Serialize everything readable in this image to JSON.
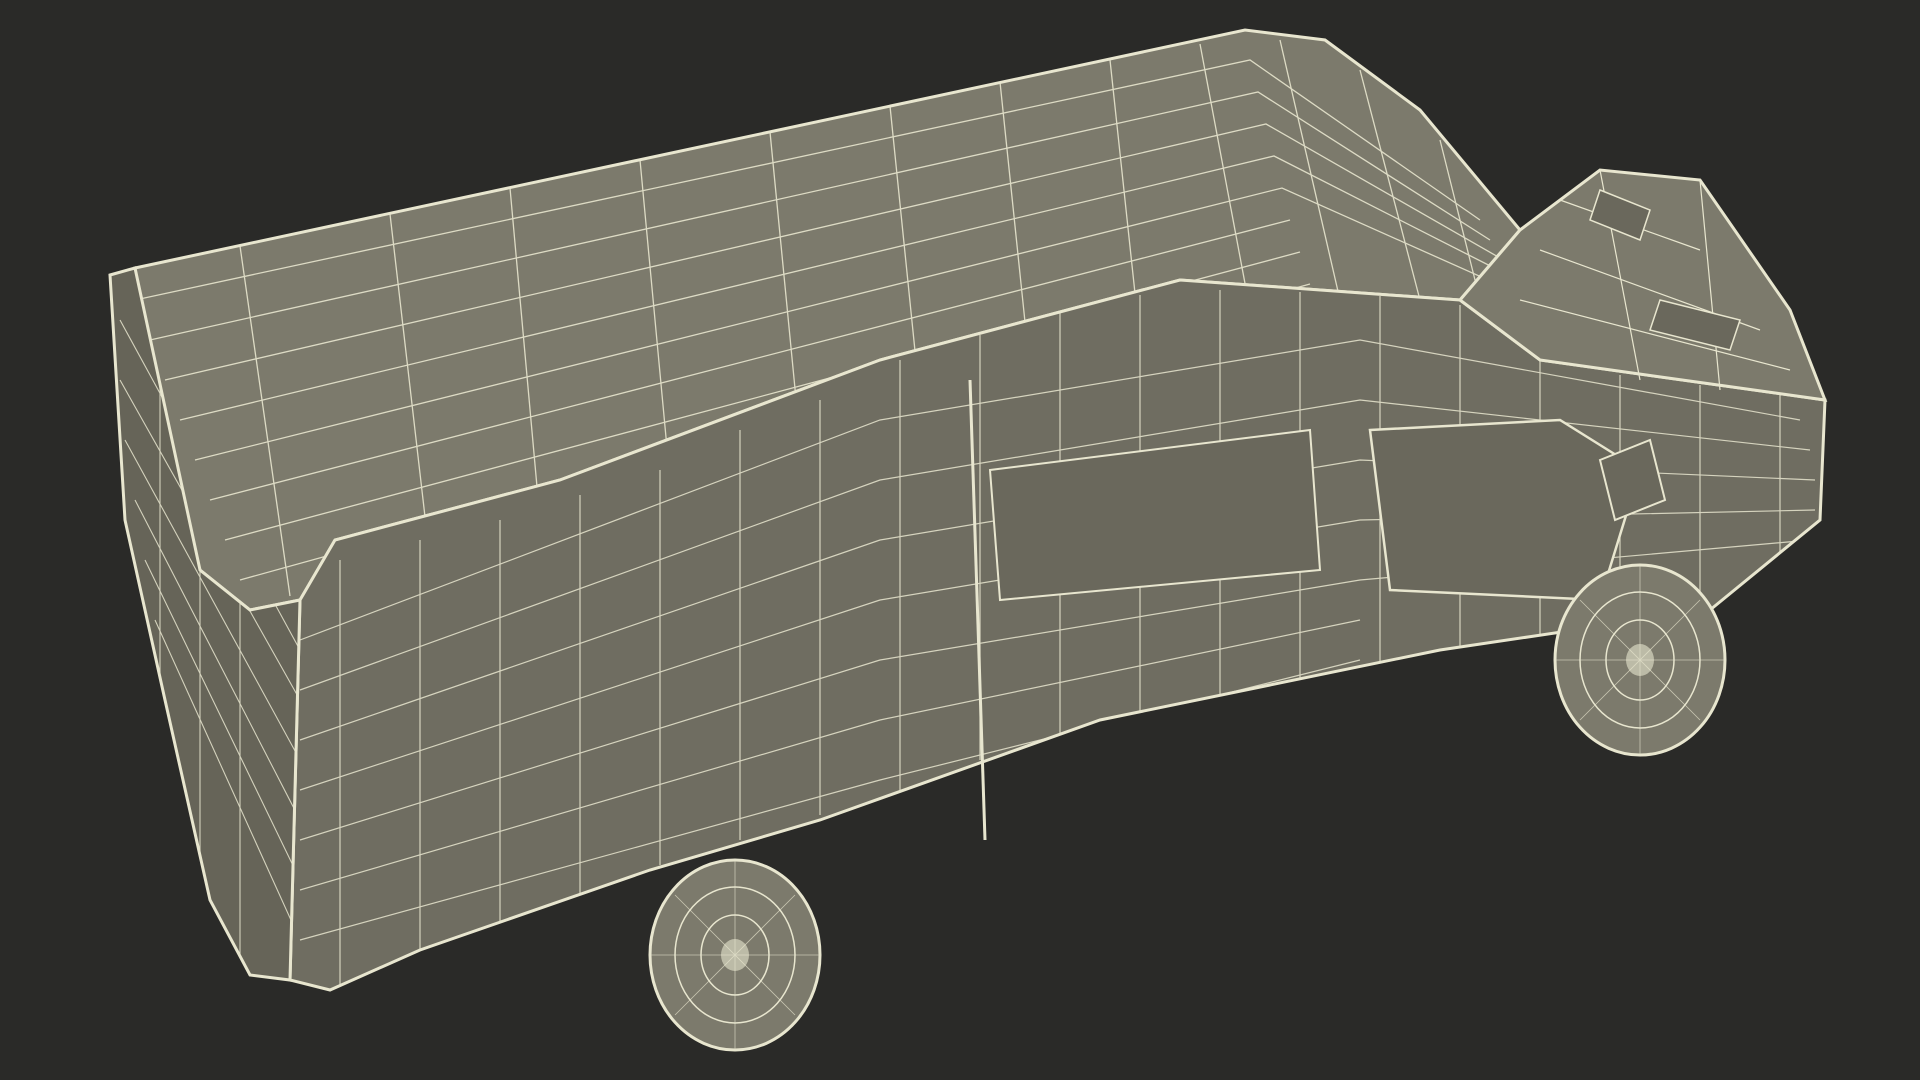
{
  "scene": {
    "subject": "van-wireframe-render",
    "colors": {
      "background": "#2a2a28",
      "surface": "#7c7a6c",
      "surface_dark": "#6a685c",
      "surface_light": "#8a887a",
      "wire": "#e8e6cf"
    }
  }
}
